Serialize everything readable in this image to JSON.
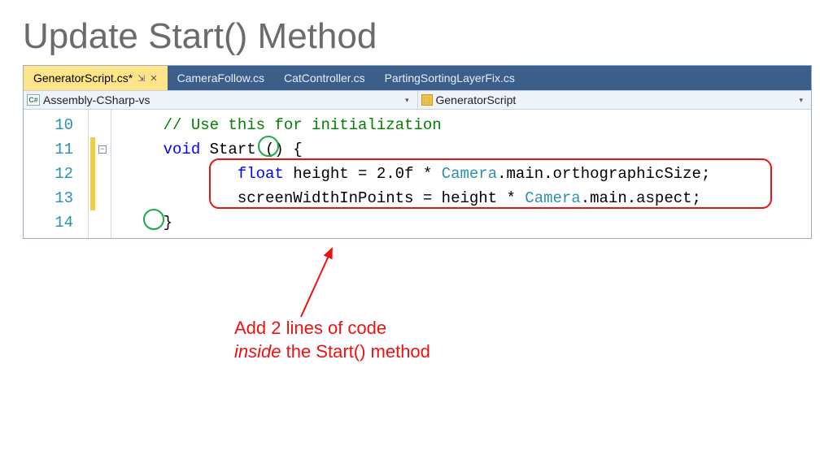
{
  "slide": {
    "title": "Update Start() Method"
  },
  "tabs": {
    "active": "GeneratorScript.cs*",
    "others": [
      "CameraFollow.cs",
      "CatController.cs",
      "PartingSortingLayerFix.cs"
    ]
  },
  "context": {
    "left": "Assembly-CSharp-vs",
    "right": "GeneratorScript"
  },
  "code": {
    "line_numbers": [
      "10",
      "11",
      "12",
      "13",
      "14"
    ],
    "l10": {
      "comment": "// Use this for initialization"
    },
    "l11": {
      "kw1": "void",
      "name": " Start () ",
      "brace": "{"
    },
    "l12": {
      "kw1": "float",
      "p1": " height = 2.0f * ",
      "ty1": "Camera",
      "p2": ".main.orthographicSize;"
    },
    "l13": {
      "p1": "screenWidthInPoints = height * ",
      "ty1": "Camera",
      "p2": ".main.aspect;"
    },
    "l14": {
      "brace": "}"
    }
  },
  "annotation": {
    "line1": "Add 2 lines of code",
    "line2a": "inside",
    "line2b": " the Start() method"
  }
}
